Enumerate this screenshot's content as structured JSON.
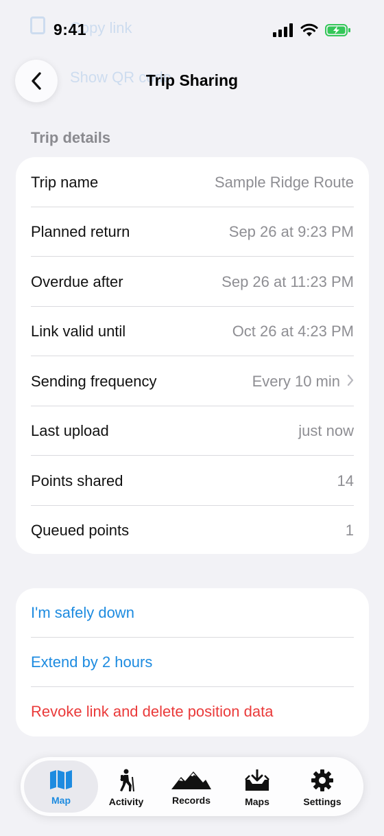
{
  "background_sheet": {
    "row1": "Copy link",
    "row2": "Show QR code"
  },
  "status_bar": {
    "time": "9:41"
  },
  "nav": {
    "title": "Trip Sharing"
  },
  "details": {
    "header": "Trip details",
    "rows": [
      {
        "label": "Trip name",
        "value": "Sample Ridge Route"
      },
      {
        "label": "Planned return",
        "value": "Sep 26 at 9:23 PM"
      },
      {
        "label": "Overdue after",
        "value": "Sep 26 at 11:23 PM"
      },
      {
        "label": "Link valid until",
        "value": "Oct 26 at 4:23 PM"
      },
      {
        "label": "Sending frequency",
        "value": "Every 10 min"
      },
      {
        "label": "Last upload",
        "value": "just now"
      },
      {
        "label": "Points shared",
        "value": "14"
      },
      {
        "label": "Queued points",
        "value": "1"
      }
    ]
  },
  "actions": {
    "safely_down": "I'm safely down",
    "extend": "Extend by 2 hours",
    "revoke": "Revoke link and delete position data"
  },
  "tabs": [
    {
      "label": "Map",
      "icon": "map-icon",
      "active": true
    },
    {
      "label": "Activity",
      "icon": "hiker-icon",
      "active": false
    },
    {
      "label": "Records",
      "icon": "mountains-icon",
      "active": false
    },
    {
      "label": "Maps",
      "icon": "inbox-download-icon",
      "active": false
    },
    {
      "label": "Settings",
      "icon": "gear-icon",
      "active": false
    }
  ],
  "colors": {
    "accent_blue": "#1d8be0",
    "destructive_red": "#ea3a3a",
    "battery_green": "#34c759"
  }
}
